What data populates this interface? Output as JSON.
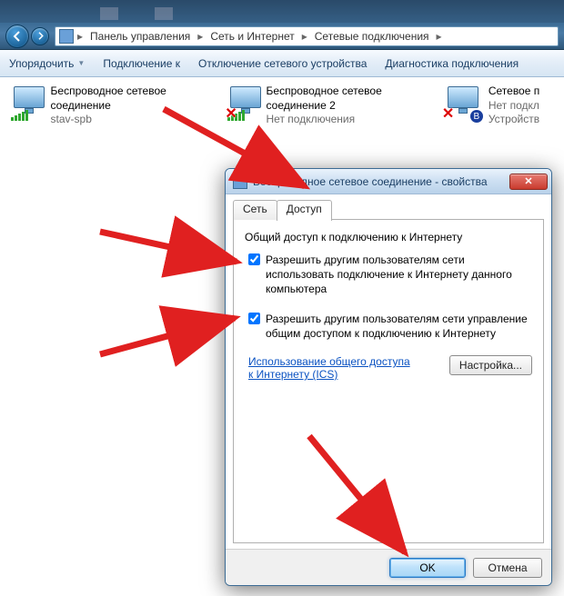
{
  "breadcrumbs": {
    "c1": "Панель управления",
    "c2": "Сеть и Интернет",
    "c3": "Сетевые подключения"
  },
  "toolbar": {
    "organize": "Упорядочить",
    "connect": "Подключение к",
    "disable": "Отключение сетевого устройства",
    "diagnose": "Диагностика подключения"
  },
  "connections": [
    {
      "name": "Беспроводное сетевое соединение",
      "status": "stav-spb",
      "disabled": false,
      "bt": false
    },
    {
      "name": "Беспроводное сетевое соединение 2",
      "status": "Нет подключения",
      "disabled": true,
      "bt": false
    },
    {
      "name": "Сетевое п",
      "status": "Нет подкл",
      "extra": "Устройств",
      "disabled": true,
      "bt": true
    }
  ],
  "dialog": {
    "title": "Беспроводное сетевое соединение - свойства",
    "tab_network": "Сеть",
    "tab_sharing": "Доступ",
    "section": "Общий доступ к подключению к Интернету",
    "chk1": "Разрешить другим пользователям сети использовать подключение к Интернету данного компьютера",
    "chk2": "Разрешить другим пользователям сети управление общим доступом к подключению к Интернету",
    "link": "Использование общего доступа к Интернету (ICS)",
    "settings_btn": "Настройка...",
    "ok": "OK",
    "cancel": "Отмена"
  }
}
